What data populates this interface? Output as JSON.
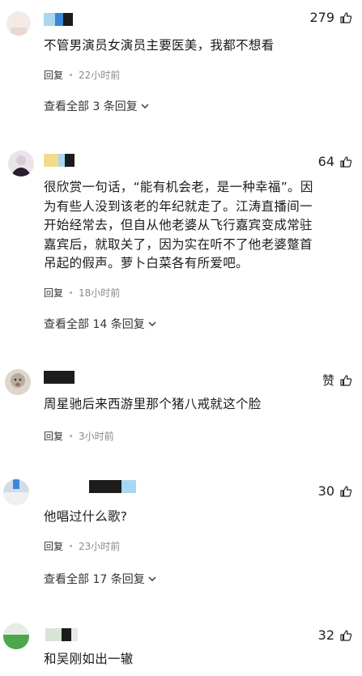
{
  "comments": [
    {
      "likes": "279",
      "text": "不管男演员女演员主要医美，我都不想看",
      "reply_label": "回复",
      "time": "22小时前",
      "view_all": "查看全部 3 条回复"
    },
    {
      "likes": "64",
      "text": "很欣赏一句话，“能有机会老，是一种幸福”。因为有些人没到该老的年纪就走了。江涛直播间一开始经常去，但自从他老婆从飞行嘉宾变成常驻嘉宾后，就取关了，因为实在听不了他老婆蹩首吊起的假声。萝卜白菜各有所爱吧。",
      "reply_label": "回复",
      "time": "18小时前",
      "view_all": "查看全部 14 条回复"
    },
    {
      "likes": "赞",
      "text": "周星驰后来西游里那个猪八戒就这个脸",
      "reply_label": "回复",
      "time": "3小时前"
    },
    {
      "likes": "30",
      "text": "他唱过什么歌?",
      "reply_label": "回复",
      "time": "23小时前",
      "view_all": "查看全部 17 条回复"
    },
    {
      "likes": "32",
      "text": "和吴刚如出一辙"
    }
  ],
  "colors": {
    "accent_blue": "#3a86d8",
    "light_blue": "#a8d8f0",
    "yellow": "#f2dc8c"
  }
}
